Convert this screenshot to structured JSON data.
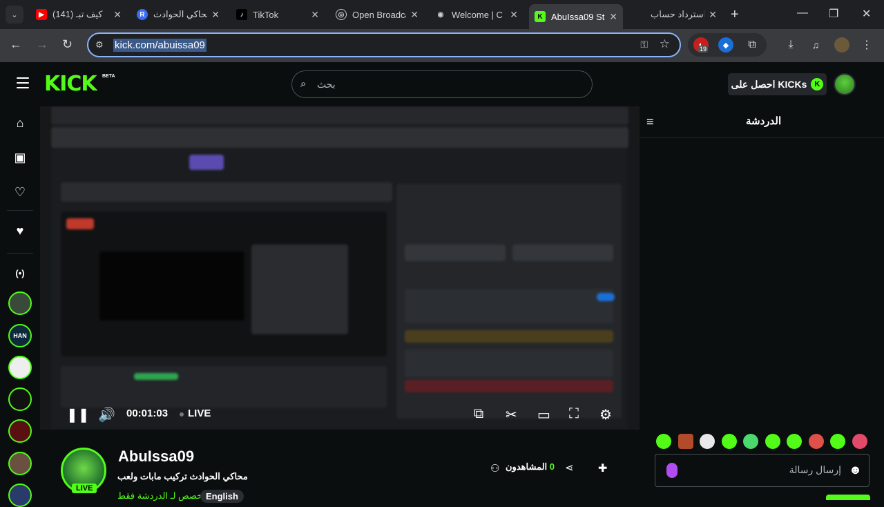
{
  "browser": {
    "tabs": [
      {
        "title": "(141) كيف تبـ",
        "fav_color": "#ff0000",
        "fav": "▶"
      },
      {
        "title": "محاكي الحوادث",
        "fav_color": "#3b6cf6",
        "fav": "R"
      },
      {
        "title": "TikTok",
        "fav_color": "#000000",
        "fav": "♪"
      },
      {
        "title": "Open Broadca",
        "fav_color": "#333333",
        "fav": "◎"
      },
      {
        "title": "Welcome | C",
        "fav_color": "#555555",
        "fav": "◉"
      },
      {
        "title": "AbuIssa09 St",
        "fav_color": "#53fc18",
        "fav": "K"
      },
      {
        "title": "استرداد حساب",
        "fav_color": "#1f2023",
        "fav": ""
      }
    ],
    "url": "kick.com/abuissa09",
    "extension_badge": "19"
  },
  "header": {
    "logo": "KICK",
    "beta": "BETA",
    "search_placeholder": "بحث",
    "get_kicks": "احصل على KICKs"
  },
  "player": {
    "time": "00:01:03",
    "live": "LIVE"
  },
  "channel": {
    "name": "AbuIssa09",
    "stream_title": "محاكي الحوادث تركيب مابات ولعب",
    "category": "مخصص لـ الدردشة فقط",
    "language": "English",
    "live_badge": "LIVE",
    "viewers_label": "المشاهدون",
    "viewers_count": "0"
  },
  "chat": {
    "title": "الدردشة",
    "input_placeholder": "إرسال رسالة"
  }
}
